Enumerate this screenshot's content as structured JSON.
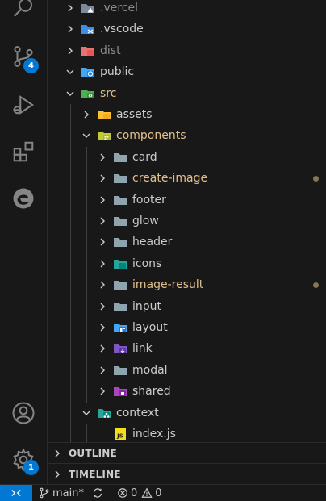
{
  "activity_bar": {
    "scm_badge": "4",
    "settings_badge": "1"
  },
  "tree": [
    {
      "label": ".vercel",
      "indent": 1,
      "expanded": false,
      "icon": "vercel-folder-icon",
      "style": "dim"
    },
    {
      "label": ".vscode",
      "indent": 1,
      "expanded": false,
      "icon": "vscode-folder-icon",
      "style": "normal"
    },
    {
      "label": "dist",
      "indent": 1,
      "expanded": false,
      "icon": "dist-folder-icon",
      "style": "dim"
    },
    {
      "label": "public",
      "indent": 1,
      "expanded": true,
      "icon": "public-folder-icon",
      "style": "normal"
    },
    {
      "label": "src",
      "indent": 1,
      "expanded": true,
      "icon": "src-folder-icon",
      "style": "mod"
    },
    {
      "label": "assets",
      "indent": 2,
      "expanded": false,
      "icon": "assets-folder-icon",
      "style": "normal"
    },
    {
      "label": "components",
      "indent": 2,
      "expanded": true,
      "icon": "components-folder-icon",
      "style": "mod"
    },
    {
      "label": "card",
      "indent": 3,
      "expanded": false,
      "icon": "folder-icon",
      "style": "normal"
    },
    {
      "label": "create-image",
      "indent": 3,
      "expanded": false,
      "icon": "folder-icon",
      "style": "mod",
      "modified": true
    },
    {
      "label": "footer",
      "indent": 3,
      "expanded": false,
      "icon": "folder-icon",
      "style": "normal"
    },
    {
      "label": "glow",
      "indent": 3,
      "expanded": false,
      "icon": "folder-icon",
      "style": "normal"
    },
    {
      "label": "header",
      "indent": 3,
      "expanded": false,
      "icon": "folder-icon",
      "style": "normal"
    },
    {
      "label": "icons",
      "indent": 3,
      "expanded": false,
      "icon": "icons-folder-icon",
      "style": "normal"
    },
    {
      "label": "image-result",
      "indent": 3,
      "expanded": false,
      "icon": "folder-icon",
      "style": "mod",
      "modified": true
    },
    {
      "label": "input",
      "indent": 3,
      "expanded": false,
      "icon": "folder-icon",
      "style": "normal"
    },
    {
      "label": "layout",
      "indent": 3,
      "expanded": false,
      "icon": "layout-folder-icon",
      "style": "normal"
    },
    {
      "label": "link",
      "indent": 3,
      "expanded": false,
      "icon": "link-folder-icon",
      "style": "normal"
    },
    {
      "label": "modal",
      "indent": 3,
      "expanded": false,
      "icon": "folder-icon",
      "style": "normal"
    },
    {
      "label": "shared",
      "indent": 3,
      "expanded": false,
      "icon": "shared-folder-icon",
      "style": "normal"
    },
    {
      "label": "context",
      "indent": 2,
      "expanded": true,
      "icon": "context-folder-icon",
      "style": "normal"
    },
    {
      "label": "index.js",
      "indent": 3,
      "expanded": null,
      "icon": "js-file-icon",
      "style": "normal"
    }
  ],
  "panels": {
    "outline": "OUTLINE",
    "timeline": "TIMELINE"
  },
  "status_bar": {
    "branch": "main*",
    "errors": "0",
    "warnings": "0"
  },
  "colors": {
    "accent": "#0078d4",
    "modified": "#e2c08d",
    "background": "#181818"
  }
}
